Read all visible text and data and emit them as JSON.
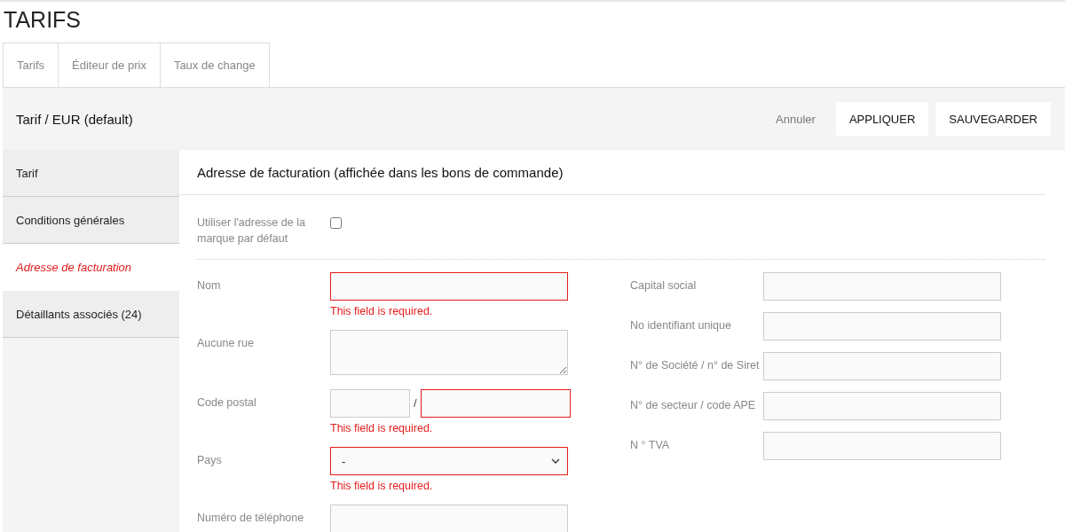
{
  "page_title": "TARIFS",
  "tabs": [
    {
      "label": "Tarifs",
      "selected": false
    },
    {
      "label": "Éditeur de prix",
      "selected": false
    },
    {
      "label": "Taux de change",
      "selected": false
    }
  ],
  "header": {
    "title": "Tarif / EUR (default)",
    "actions": [
      {
        "label": "Annuler",
        "kind": "link"
      },
      {
        "label": "APPLIQUER",
        "kind": "button"
      },
      {
        "label": "SAUVEGARDER",
        "kind": "button"
      }
    ]
  },
  "sidebar": {
    "items": [
      {
        "label": "Tarif",
        "selected": false
      },
      {
        "label": "Conditions générales",
        "selected": false
      },
      {
        "label": "Adresse de facturation",
        "selected": true
      },
      {
        "label": "Détaillants associés (24)",
        "selected": false
      }
    ]
  },
  "section": {
    "title": "Adresse de facturation (affichée dans les bons de commande)",
    "default_address": {
      "label": "Utiliser l'adresse de la marque par défaut",
      "checked": false
    },
    "left_fields": [
      {
        "label": "Nom",
        "kind": "text",
        "invalid": true,
        "error": "This field is required."
      },
      {
        "label": "Aucune rue",
        "kind": "textarea",
        "invalid": false
      },
      {
        "label": "Code postal",
        "kind": "pair",
        "separator": "/",
        "parts": [
          {
            "invalid": false
          },
          {
            "invalid": true
          }
        ],
        "error": "This field is required."
      },
      {
        "label": "Pays",
        "kind": "select",
        "value": "-",
        "invalid": true,
        "error": "This field is required."
      },
      {
        "label": "Numéro de téléphone",
        "kind": "text",
        "invalid": false
      }
    ],
    "right_fields": [
      {
        "label": "Capital social"
      },
      {
        "label": "No identifiant unique"
      },
      {
        "label": "N° de Société / n° de Siret"
      },
      {
        "label": "N° de secteur / code APE"
      },
      {
        "label": "N ° TVA"
      }
    ]
  }
}
